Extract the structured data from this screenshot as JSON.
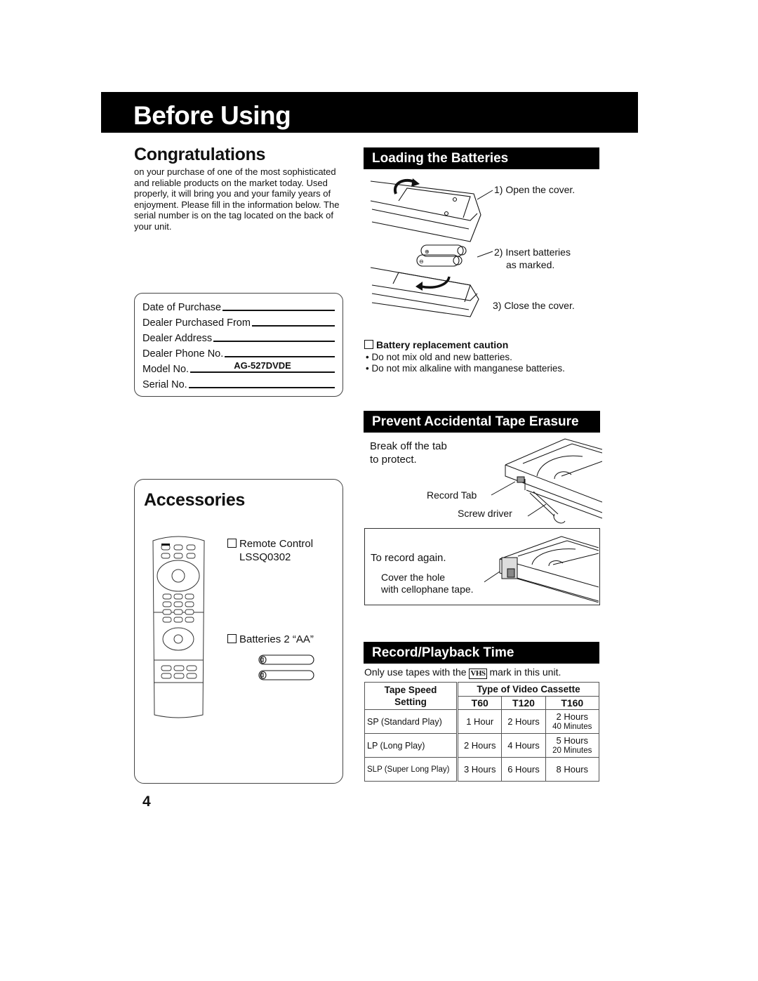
{
  "header": {
    "title": "Before Using"
  },
  "congratulations": {
    "title": "Congratulations",
    "body": "on your purchase of one of the most sophisticated and reliable products on the market today. Used properly, it will bring you and your family years of enjoyment. Please fill in the information below. The serial number is on the tag located on the back of your unit."
  },
  "info_form": {
    "rows": [
      {
        "label": "Date of Purchase",
        "value": ""
      },
      {
        "label": "Dealer Purchased From",
        "value": ""
      },
      {
        "label": "Dealer Address",
        "value": ""
      },
      {
        "label": "Dealer Phone No.",
        "value": ""
      },
      {
        "label": "Model No.",
        "value": "AG-527DVDE"
      },
      {
        "label": "Serial No.",
        "value": ""
      }
    ]
  },
  "batteries": {
    "title": "Loading the Batteries",
    "steps": [
      "1) Open the cover.",
      "2) Insert batteries",
      "as marked.",
      "3) Close the cover."
    ],
    "caution_title": "Battery replacement caution",
    "caution_items": [
      "Do not mix old and new batteries.",
      "Do not mix alkaline with manganese batteries."
    ]
  },
  "erasure": {
    "title": "Prevent Accidental Tape Erasure",
    "instruction_line1": "Break off the tab",
    "instruction_line2": "to protect.",
    "record_tab_label": "Record Tab",
    "screwdriver_label": "Screw driver",
    "record_again_title": "To record again.",
    "cover_line1": "Cover the hole",
    "cover_line2": "with cellophane tape."
  },
  "accessories": {
    "title": "Accessories",
    "items": [
      {
        "name": "Remote Control",
        "part": "LSSQ0302"
      },
      {
        "name": "Batteries 2 “AA”",
        "part": ""
      }
    ]
  },
  "playback": {
    "title": "Record/Playback Time",
    "note_before": "Only use tapes with the",
    "vhs_mark": "VHS",
    "note_after": "mark in this unit.",
    "col_header_speed_1": "Tape Speed",
    "col_header_speed_2": "Setting",
    "col_header_type": "Type of Video Cassette",
    "columns": [
      "T60",
      "T120",
      "T160"
    ],
    "rows": [
      {
        "speed": "SP (Standard Play)",
        "t60": "1 Hour",
        "t120": "2 Hours",
        "t160": "2 Hours",
        "t160_sub": "40 Minutes"
      },
      {
        "speed": "LP (Long Play)",
        "t60": "2 Hours",
        "t120": "4 Hours",
        "t160": "5 Hours",
        "t160_sub": "20 Minutes"
      },
      {
        "speed": "SLP (Super Long Play)",
        "t60": "3 Hours",
        "t120": "6 Hours",
        "t160": "8 Hours",
        "t160_sub": ""
      }
    ]
  },
  "page_number": "4"
}
